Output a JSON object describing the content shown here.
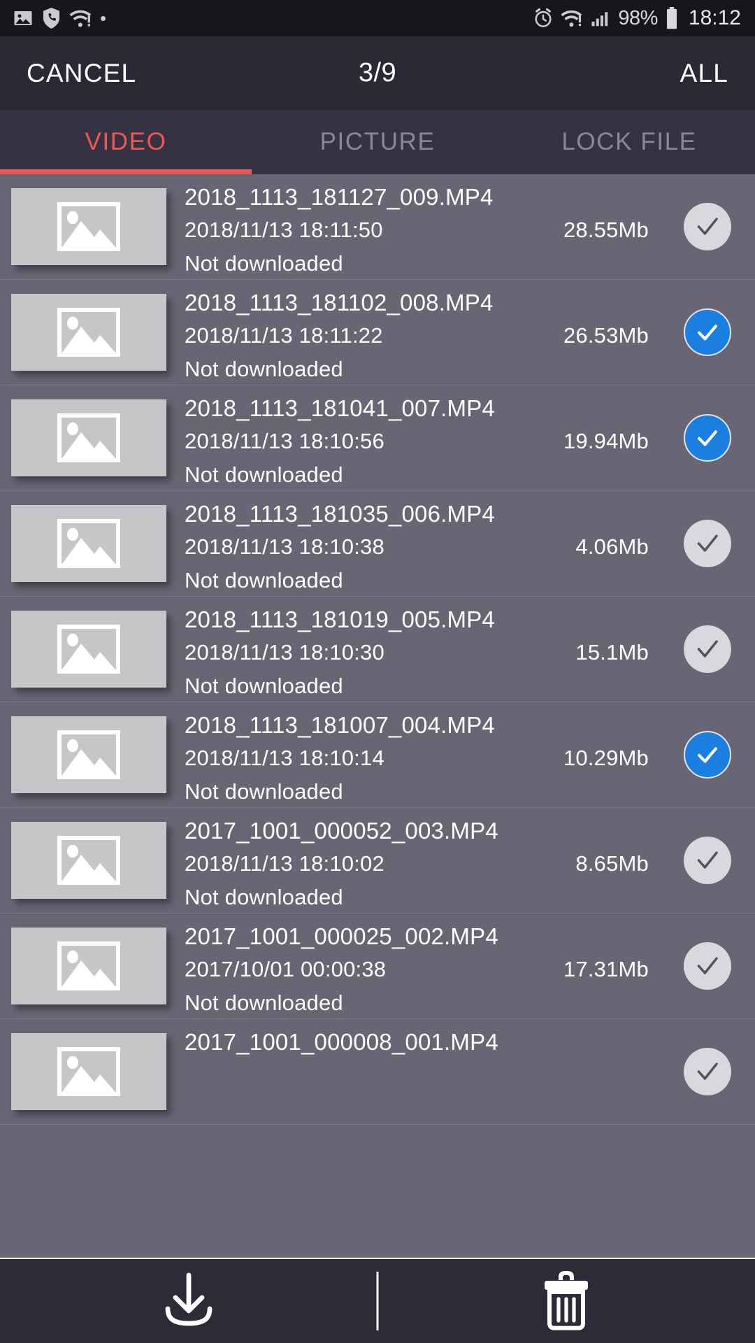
{
  "statusbar": {
    "icons_left": [
      "image-icon",
      "call-shield-icon",
      "wifi-alert-icon",
      "dot-icon"
    ],
    "icons_right": [
      "alarm-icon",
      "wifi-alert-icon",
      "signal-bars-icon"
    ],
    "battery_percent": "98%",
    "clock": "18:12"
  },
  "actionbar": {
    "cancel_label": "CANCEL",
    "count_label": "3/9",
    "all_label": "ALL"
  },
  "tabs": [
    {
      "label": "VIDEO",
      "active": true
    },
    {
      "label": "PICTURE",
      "active": false
    },
    {
      "label": "LOCK FILE",
      "active": false
    }
  ],
  "colors": {
    "accent_red": "#e8574f",
    "selected_blue": "#1a7fe0",
    "list_bg": "#6a6575",
    "bar_bg": "#2a2936",
    "tab_bg": "#353343"
  },
  "files": [
    {
      "name": "2018_1113_181127_009.MP4",
      "date": "2018/11/13 18:11:50",
      "size": "28.55Mb",
      "status": "Not downloaded",
      "selected": false
    },
    {
      "name": "2018_1113_181102_008.MP4",
      "date": "2018/11/13 18:11:22",
      "size": "26.53Mb",
      "status": "Not downloaded",
      "selected": true
    },
    {
      "name": "2018_1113_181041_007.MP4",
      "date": "2018/11/13 18:10:56",
      "size": "19.94Mb",
      "status": "Not downloaded",
      "selected": true
    },
    {
      "name": "2018_1113_181035_006.MP4",
      "date": "2018/11/13 18:10:38",
      "size": "4.06Mb",
      "status": "Not downloaded",
      "selected": false
    },
    {
      "name": "2018_1113_181019_005.MP4",
      "date": "2018/11/13 18:10:30",
      "size": "15.1Mb",
      "status": "Not downloaded",
      "selected": false
    },
    {
      "name": "2018_1113_181007_004.MP4",
      "date": "2018/11/13 18:10:14",
      "size": "10.29Mb",
      "status": "Not downloaded",
      "selected": true
    },
    {
      "name": "2017_1001_000052_003.MP4",
      "date": "2018/11/13 18:10:02",
      "size": "8.65Mb",
      "status": "Not downloaded",
      "selected": false
    },
    {
      "name": "2017_1001_000025_002.MP4",
      "date": "2017/10/01 00:00:38",
      "size": "17.31Mb",
      "status": "Not downloaded",
      "selected": false
    },
    {
      "name": "2017_1001_000008_001.MP4",
      "date": "",
      "size": "",
      "status": "",
      "selected": false
    }
  ],
  "bottombar": {
    "download_label": "download-button",
    "delete_label": "delete-button"
  }
}
